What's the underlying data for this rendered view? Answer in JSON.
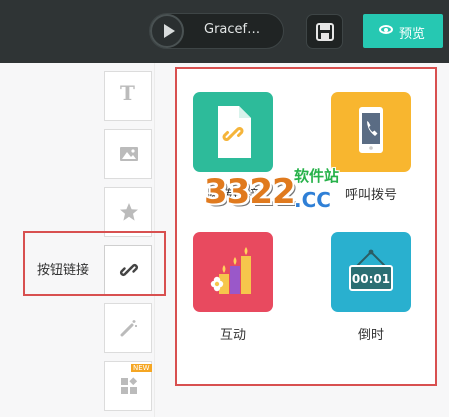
{
  "topbar": {
    "music_title": "Gracef…",
    "preview_label": "预览"
  },
  "side_tools": {
    "items": [
      {
        "name": "text-tool",
        "icon": "text-T-icon"
      },
      {
        "name": "image-tool",
        "icon": "image-icon"
      },
      {
        "name": "shape-tool",
        "icon": "star-icon"
      },
      {
        "name": "button-link-tool",
        "icon": "link-icon",
        "label": "按钮链接"
      },
      {
        "name": "effect-tool",
        "icon": "magic-wand-icon"
      },
      {
        "name": "component-tool",
        "icon": "widgets-icon",
        "badge": "NEW"
      }
    ]
  },
  "panel": {
    "items": [
      {
        "label": "跳转链接",
        "icon": "file-link-icon",
        "color": "#2dbb9a"
      },
      {
        "label": "呼叫拨号",
        "icon": "phone-icon",
        "color": "#f8b62f"
      },
      {
        "label": "互动",
        "icon": "candles-icon",
        "color": "#e84a5f"
      },
      {
        "label": "倒时",
        "icon": "countdown-icon",
        "color": "#29b0cf",
        "display": "00:01"
      }
    ]
  },
  "watermark": {
    "sites": "软件站",
    "main": "3322",
    "domain": ".CC"
  },
  "colors": {
    "topbar": "#2f3435",
    "accent": "#26c8b2",
    "highlight_box": "#d85050"
  }
}
